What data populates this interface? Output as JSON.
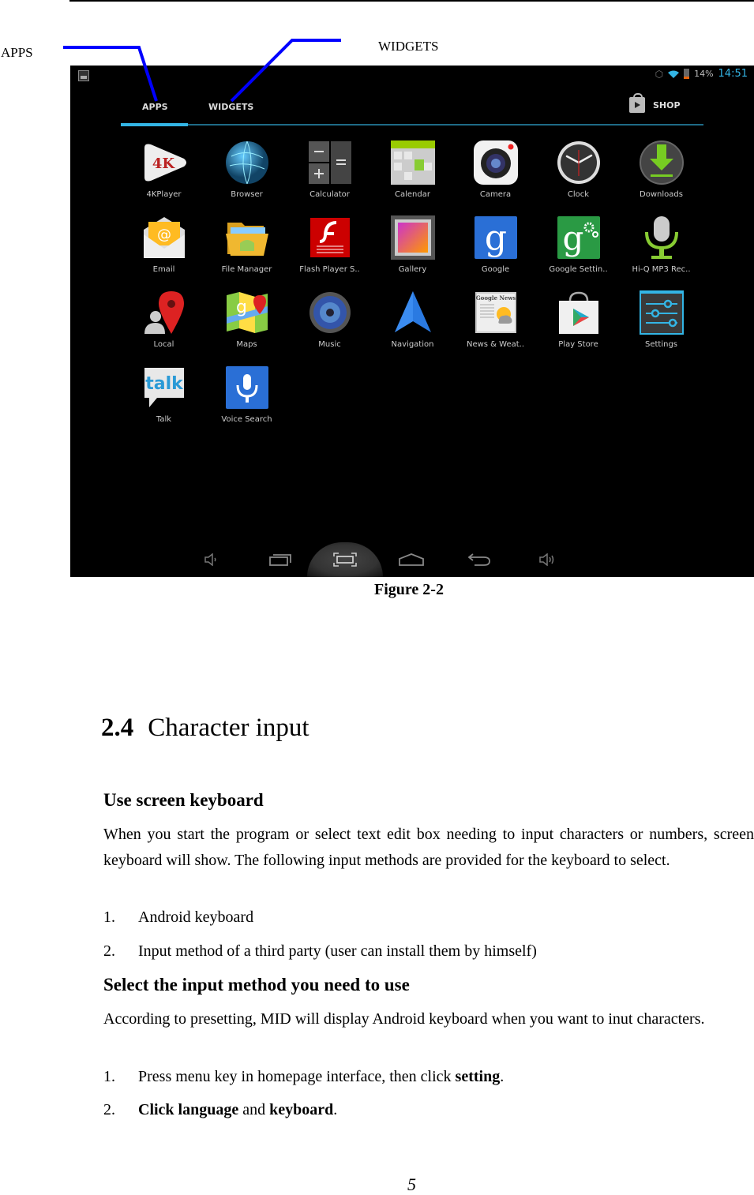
{
  "callouts": {
    "apps": "APPS",
    "widgets": "WIDGETS"
  },
  "screen": {
    "status_bar": {
      "battery_percent": "14%",
      "time": "14:51"
    },
    "tabs": [
      {
        "label": "APPS",
        "active": true
      },
      {
        "label": "WIDGETS",
        "active": false
      }
    ],
    "shop_label": "SHOP",
    "apps": [
      {
        "label": "4KPlayer",
        "icon": "4kplayer-icon"
      },
      {
        "label": "Browser",
        "icon": "browser-globe-icon"
      },
      {
        "label": "Calculator",
        "icon": "calculator-icon"
      },
      {
        "label": "Calendar",
        "icon": "calendar-icon"
      },
      {
        "label": "Camera",
        "icon": "camera-icon"
      },
      {
        "label": "Clock",
        "icon": "clock-icon"
      },
      {
        "label": "Downloads",
        "icon": "download-icon"
      },
      {
        "label": "Email",
        "icon": "email-icon"
      },
      {
        "label": "File Manager",
        "icon": "folder-icon"
      },
      {
        "label": "Flash Player S..",
        "icon": "flash-icon"
      },
      {
        "label": "Gallery",
        "icon": "gallery-icon"
      },
      {
        "label": "Google",
        "icon": "google-icon"
      },
      {
        "label": "Google Settin..",
        "icon": "google-settings-icon"
      },
      {
        "label": "Hi-Q MP3 Rec..",
        "icon": "microphone-icon"
      },
      {
        "label": "Local",
        "icon": "map-pin-icon"
      },
      {
        "label": "Maps",
        "icon": "maps-icon"
      },
      {
        "label": "Music",
        "icon": "speaker-icon"
      },
      {
        "label": "Navigation",
        "icon": "navigation-arrow-icon"
      },
      {
        "label": "News & Weat..",
        "icon": "news-icon"
      },
      {
        "label": "Play Store",
        "icon": "play-store-icon"
      },
      {
        "label": "Settings",
        "icon": "settings-sliders-icon"
      },
      {
        "label": "Talk",
        "icon": "talk-icon"
      },
      {
        "label": "Voice Search",
        "icon": "voice-search-icon"
      }
    ],
    "nav_buttons": [
      "volume-down-icon",
      "recent-apps-icon",
      "screenshot-icon",
      "home-icon",
      "back-icon",
      "volume-up-icon"
    ]
  },
  "figure_caption": "Figure 2-2",
  "section": {
    "number": "2.4",
    "title": "Character input"
  },
  "subsection1": {
    "heading": "Use screen keyboard",
    "paragraph": "When you start the program or select text edit box needing to input characters or numbers, screen keyboard will show. The following input methods are provided for the keyboard to select.",
    "items": [
      {
        "num": "1.",
        "text": "Android keyboard"
      },
      {
        "num": "2.",
        "text": "Input method of a third party (user can install them by himself)"
      }
    ]
  },
  "subsection2": {
    "heading": "Select the input method you need to use",
    "paragraph": "According to presetting, MID will display Android keyboard when you want to inut characters.",
    "item1": {
      "num": "1.",
      "text": "Press menu key in homepage interface, then click ",
      "bold": "setting",
      "tail": "."
    },
    "item2": {
      "num": "2.",
      "bold1": "Click language",
      "mid": " and ",
      "bold2": "keyboard",
      "tail": "."
    }
  },
  "page_number": "5"
}
